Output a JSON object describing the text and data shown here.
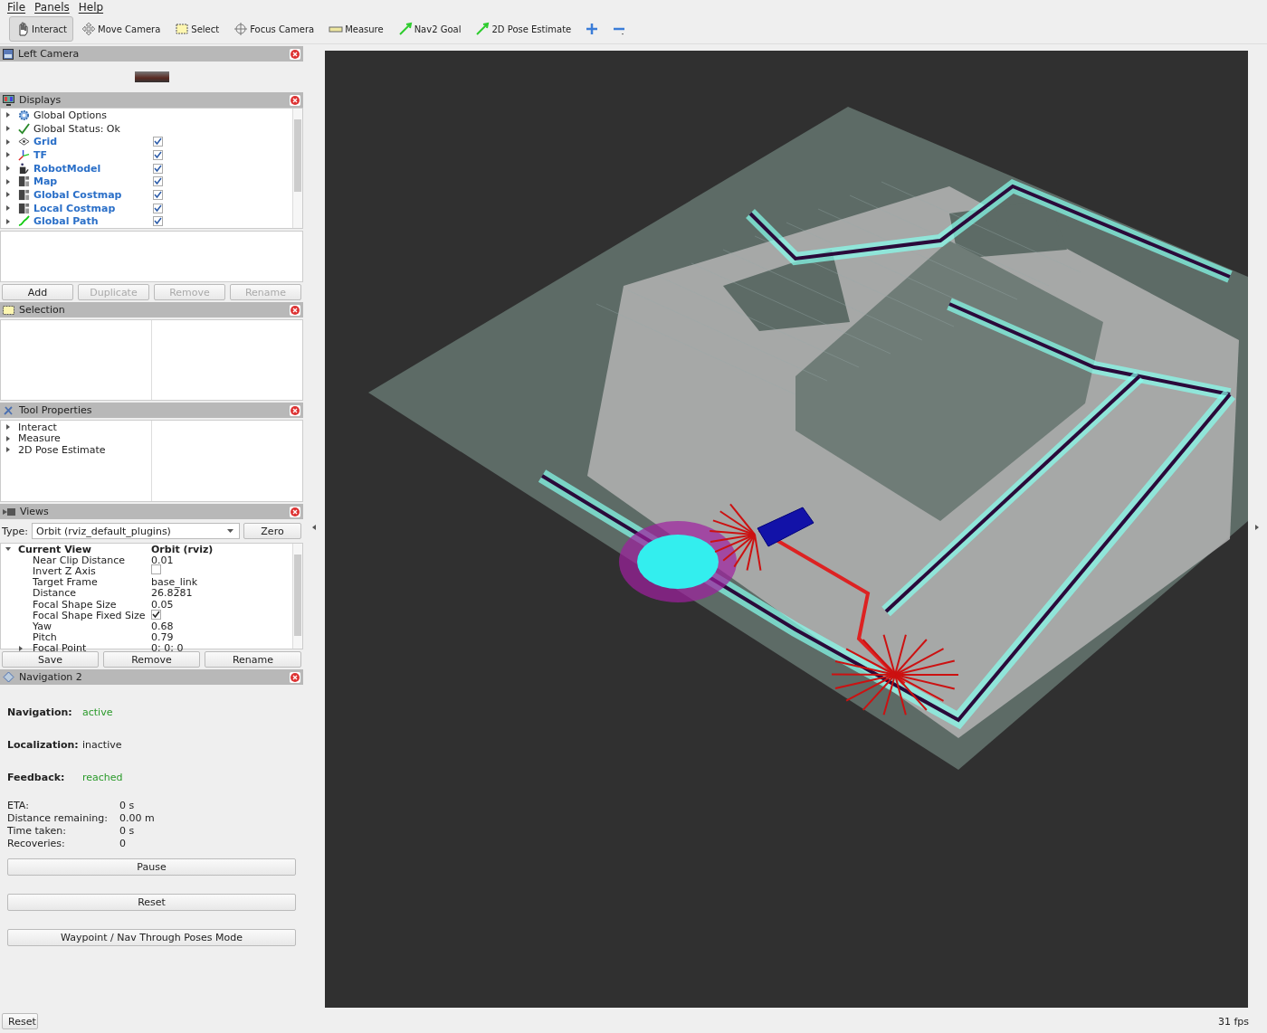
{
  "menu": [
    "File",
    "Panels",
    "Help"
  ],
  "toolbar": [
    {
      "label": "Interact",
      "kind": "hand",
      "selected": true
    },
    {
      "label": "Move Camera",
      "kind": "move",
      "selected": false
    },
    {
      "label": "Select",
      "kind": "select",
      "selected": false
    },
    {
      "label": "Focus Camera",
      "kind": "focus",
      "selected": false
    },
    {
      "label": "Measure",
      "kind": "ruler",
      "selected": false
    },
    {
      "label": "Nav2 Goal",
      "kind": "arrow",
      "selected": false
    },
    {
      "label": "2D Pose Estimate",
      "kind": "arrow",
      "selected": false
    },
    {
      "kind": "plus",
      "selected": false
    },
    {
      "kind": "minus",
      "selected": false
    }
  ],
  "left_camera": {
    "title": "Left Camera"
  },
  "displays": {
    "title": "Displays",
    "items": [
      {
        "label": "Global Options",
        "kind": "options",
        "enabled": false
      },
      {
        "label": "Global Status: Ok",
        "kind": "status",
        "enabled": false
      },
      {
        "label": "Grid",
        "kind": "grid",
        "enabled": true,
        "checked": true
      },
      {
        "label": "TF",
        "kind": "tf",
        "enabled": true,
        "checked": true
      },
      {
        "label": "RobotModel",
        "kind": "robot",
        "enabled": true,
        "checked": true
      },
      {
        "label": "Map",
        "kind": "map",
        "enabled": true,
        "checked": true
      },
      {
        "label": "Global Costmap",
        "kind": "map",
        "enabled": true,
        "checked": true
      },
      {
        "label": "Local Costmap",
        "kind": "map",
        "enabled": true,
        "checked": true
      },
      {
        "label": "Global Path",
        "kind": "path",
        "enabled": true,
        "checked": true
      }
    ],
    "buttons": [
      {
        "label": "Add",
        "disabled": false
      },
      {
        "label": "Duplicate",
        "disabled": true
      },
      {
        "label": "Remove",
        "disabled": true
      },
      {
        "label": "Rename",
        "disabled": true
      }
    ]
  },
  "selection": {
    "title": "Selection"
  },
  "tool_properties": {
    "title": "Tool Properties",
    "items": [
      "Interact",
      "Measure",
      "2D Pose Estimate"
    ]
  },
  "views": {
    "title": "Views",
    "type_label": "Type:",
    "type_value": "Orbit (rviz_default_plugins)",
    "zero_button": "Zero",
    "current_view": {
      "label": "Current View",
      "value": "Orbit (rviz)",
      "expanded": true
    },
    "properties": [
      {
        "label": "Near Clip Distance",
        "kind": "text",
        "value": "0.01"
      },
      {
        "label": "Invert Z Axis",
        "kind": "check",
        "checked": false
      },
      {
        "label": "Target Frame",
        "kind": "text",
        "value": "base_link"
      },
      {
        "label": "Distance",
        "kind": "text",
        "value": "26.8281"
      },
      {
        "label": "Focal Shape Size",
        "kind": "text",
        "value": "0.05"
      },
      {
        "label": "Focal Shape Fixed Size",
        "kind": "check",
        "checked": true
      },
      {
        "label": "Yaw",
        "kind": "text",
        "value": "0.68"
      },
      {
        "label": "Pitch",
        "kind": "text",
        "value": "0.79"
      },
      {
        "label": "Focal Point",
        "kind": "group",
        "value": "0; 0; 0"
      }
    ],
    "buttons": [
      "Save",
      "Remove",
      "Rename"
    ]
  },
  "navigation": {
    "title": "Navigation 2",
    "status": [
      {
        "label": "Navigation:",
        "value": "active",
        "ok": true
      },
      {
        "label": "Localization:",
        "value": "inactive",
        "ok": false
      },
      {
        "label": "Feedback:",
        "value": "reached",
        "ok": true
      }
    ],
    "stats": [
      {
        "label": "ETA:",
        "value": "0 s"
      },
      {
        "label": "Distance remaining:",
        "value": "0.00 m"
      },
      {
        "label": "Time taken:",
        "value": "0 s"
      },
      {
        "label": "Recoveries:",
        "value": "0"
      }
    ],
    "buttons": [
      "Pause",
      "Reset",
      "Waypoint / Nav Through Poses Mode"
    ]
  },
  "footer": {
    "reset": "Reset",
    "fps": "31 fps"
  }
}
